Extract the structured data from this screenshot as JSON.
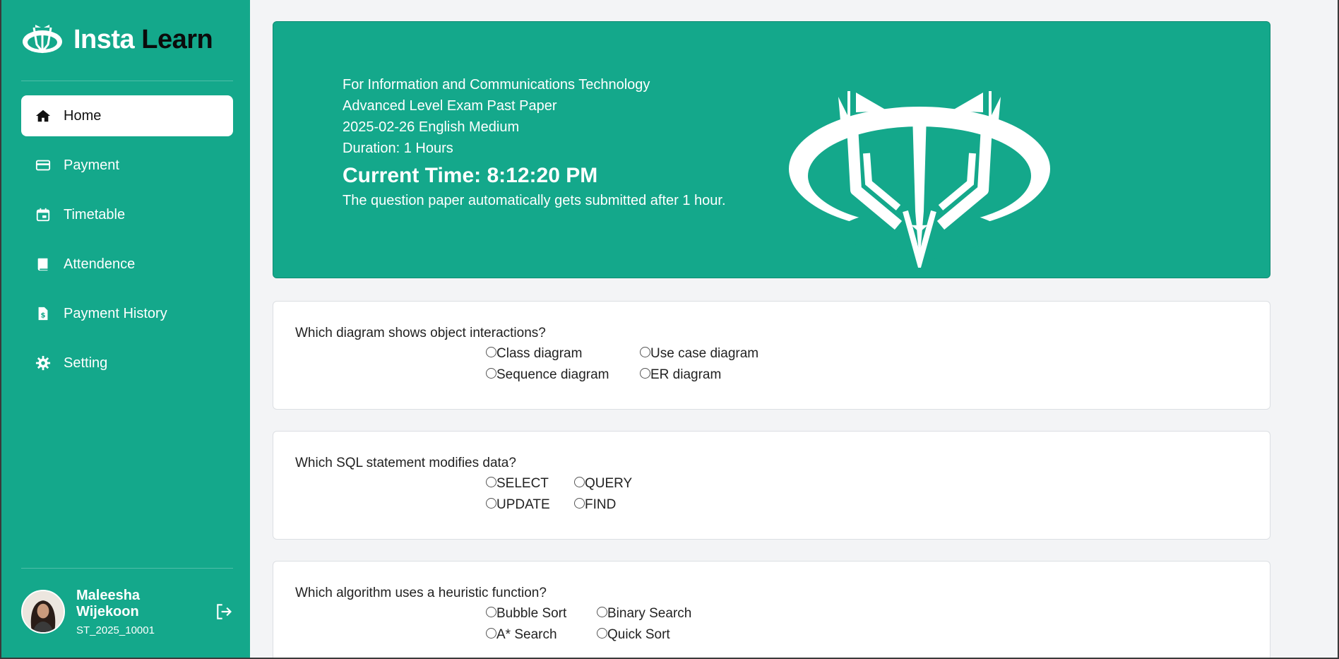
{
  "brand": {
    "part1": "Insta",
    "part2": "Learn"
  },
  "colors": {
    "primary": "#14a88b",
    "background": "#f3f4f6"
  },
  "nav": [
    {
      "label": "Home",
      "icon": "home-icon",
      "active": true
    },
    {
      "label": "Payment",
      "icon": "credit-card-icon"
    },
    {
      "label": "Timetable",
      "icon": "calendar-icon"
    },
    {
      "label": "Attendence",
      "icon": "book-icon"
    },
    {
      "label": "Payment History",
      "icon": "dollar-document-icon"
    },
    {
      "label": "Setting",
      "icon": "gear-icon"
    }
  ],
  "user": {
    "name": "Maleesha Wijekoon",
    "id": "ST_2025_10001"
  },
  "banner": {
    "line1": "For Information and Communications Technology",
    "line2": "Advanced Level Exam Past Paper",
    "line3": "2025-02-26 English Medium",
    "duration": "Duration: 1 Hours",
    "time": "Current Time: 8:12:20 PM",
    "note": "The question paper automatically gets submitted after 1 hour."
  },
  "questions": [
    {
      "text": "Which diagram shows object interactions?",
      "options": [
        "Class diagram",
        "Use case diagram",
        "Sequence diagram",
        "ER diagram"
      ]
    },
    {
      "text": "Which SQL statement modifies data?",
      "options": [
        "SELECT",
        "QUERY",
        "UPDATE",
        "FIND"
      ]
    },
    {
      "text": "Which algorithm uses a heuristic function?",
      "options": [
        "Bubble Sort",
        "Binary Search",
        "A* Search",
        "Quick Sort"
      ]
    }
  ]
}
